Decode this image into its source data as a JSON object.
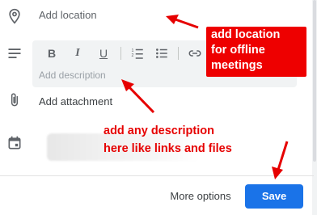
{
  "location": {
    "placeholder": "Add location",
    "icon": "location-pin-icon"
  },
  "description": {
    "placeholder": "Add description",
    "toolbar": [
      {
        "name": "bold",
        "label": "B",
        "icon": "bold-icon"
      },
      {
        "name": "italic",
        "label": "I",
        "icon": "italic-icon"
      },
      {
        "name": "underline",
        "label": "U",
        "icon": "underline-icon"
      },
      {
        "name": "numbered-list",
        "icon": "numbered-list-icon"
      },
      {
        "name": "bulleted-list",
        "icon": "bulleted-list-icon"
      },
      {
        "name": "link",
        "icon": "link-icon"
      }
    ]
  },
  "attachment": {
    "label": "Add attachment",
    "icon": "paperclip-icon"
  },
  "calendar": {
    "icon": "calendar-icon"
  },
  "footer": {
    "more_options_label": "More options",
    "save_label": "Save"
  },
  "annotations": {
    "location_note_lines": [
      "add location",
      "for offline",
      "meetings"
    ],
    "description_note_lines": [
      "add any description",
      "here like links and files"
    ]
  },
  "colors": {
    "accent": "#1a73e8",
    "annotation": "#e60000",
    "editor_bg": "#f1f3f4"
  }
}
